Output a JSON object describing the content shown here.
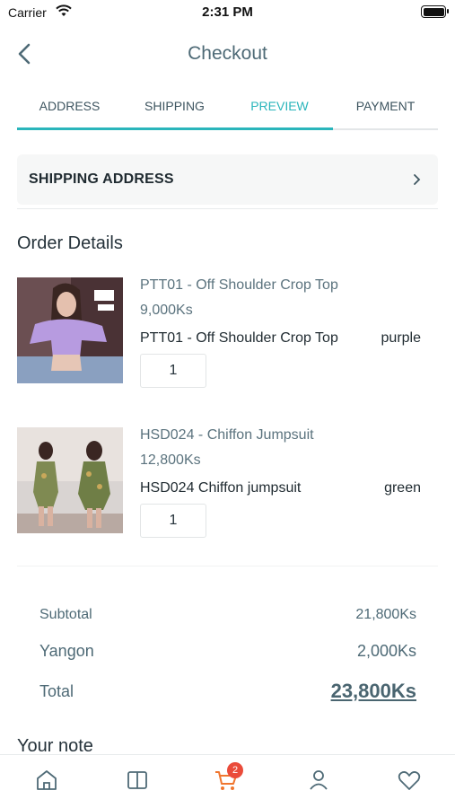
{
  "status_bar": {
    "carrier": "Carrier",
    "time": "2:31 PM"
  },
  "header": {
    "title": "Checkout"
  },
  "tabs": [
    {
      "label": "ADDRESS"
    },
    {
      "label": "SHIPPING"
    },
    {
      "label": "PREVIEW"
    },
    {
      "label": "PAYMENT"
    }
  ],
  "active_tab": "PREVIEW",
  "shipping_address": {
    "label": "SHIPPING ADDRESS"
  },
  "order_details": {
    "title": "Order Details",
    "items": [
      {
        "name": "PTT01 - Off Shoulder Crop Top",
        "price": "9,000Ks",
        "variant": "PTT01 - Off Shoulder Crop Top",
        "color": "purple",
        "quantity": "1"
      },
      {
        "name": "HSD024 - Chiffon Jumpsuit",
        "price": "12,800Ks",
        "variant": "HSD024 Chiffon jumpsuit",
        "color": "green",
        "quantity": "1"
      }
    ]
  },
  "summary": {
    "subtotal_label": "Subtotal",
    "subtotal_value": "21,800Ks",
    "delivery_label": "Yangon",
    "delivery_value": "2,000Ks",
    "total_label": "Total",
    "total_value": "23,800Ks"
  },
  "note": {
    "title": "Your note"
  },
  "bottom_nav": {
    "items": [
      {
        "icon": "home-icon"
      },
      {
        "icon": "catalog-icon"
      },
      {
        "icon": "cart-icon",
        "badge": "2"
      },
      {
        "icon": "profile-icon"
      },
      {
        "icon": "heart-icon"
      }
    ]
  },
  "colors": {
    "accent": "#2ab5bb",
    "text": "#4e6a76",
    "badge": "#ea4b3a",
    "cart": "#f0762f"
  }
}
